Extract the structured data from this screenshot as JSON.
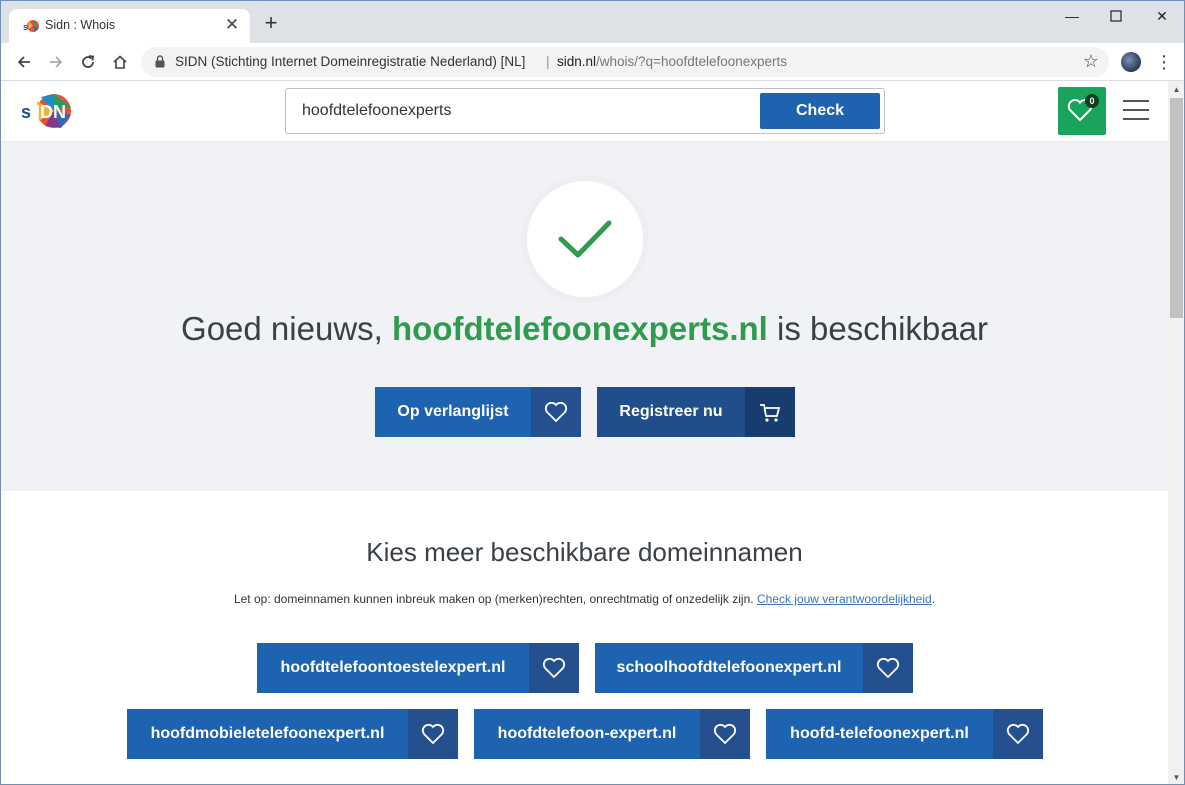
{
  "browser": {
    "tab_title": "Sidn : Whois",
    "site_name": "SIDN (Stichting Internet Domeinregistratie Nederland) [NL]",
    "url_host": "sidn.nl",
    "url_path": "/whois/?q=hoofdtelefoonexperts"
  },
  "header": {
    "search_value": "hoofdtelefoonexperts",
    "check_label": "Check",
    "wishlist_count": "0"
  },
  "hero": {
    "prefix": "Goed nieuws, ",
    "domain": "hoofdtelefoonexperts.nl",
    "suffix": " is beschikbaar",
    "wishlist_label": "Op verlanglijst",
    "register_label": "Registreer nu"
  },
  "more": {
    "title": "Kies meer beschikbare domeinnamen",
    "note": "Let op: domeinnamen kunnen inbreuk maken op (merken)rechten, onrechtmatig of onzedelijk zijn.",
    "note_link": "Check jouw verantwoordelijkheid",
    "note_end": ".",
    "suggestions": [
      "hoofdtelefoontoestelexpert.nl",
      "schoolhoofdtelefoonexpert.nl",
      "hoofdmobieletelefoonexpert.nl",
      "hoofdtelefoon-expert.nl",
      "hoofd-telefoonexpert.nl"
    ]
  },
  "colors": {
    "primary_blue": "#1d63b0",
    "success_green": "#2f9b4f",
    "wishlist_green": "#1aa35a"
  }
}
